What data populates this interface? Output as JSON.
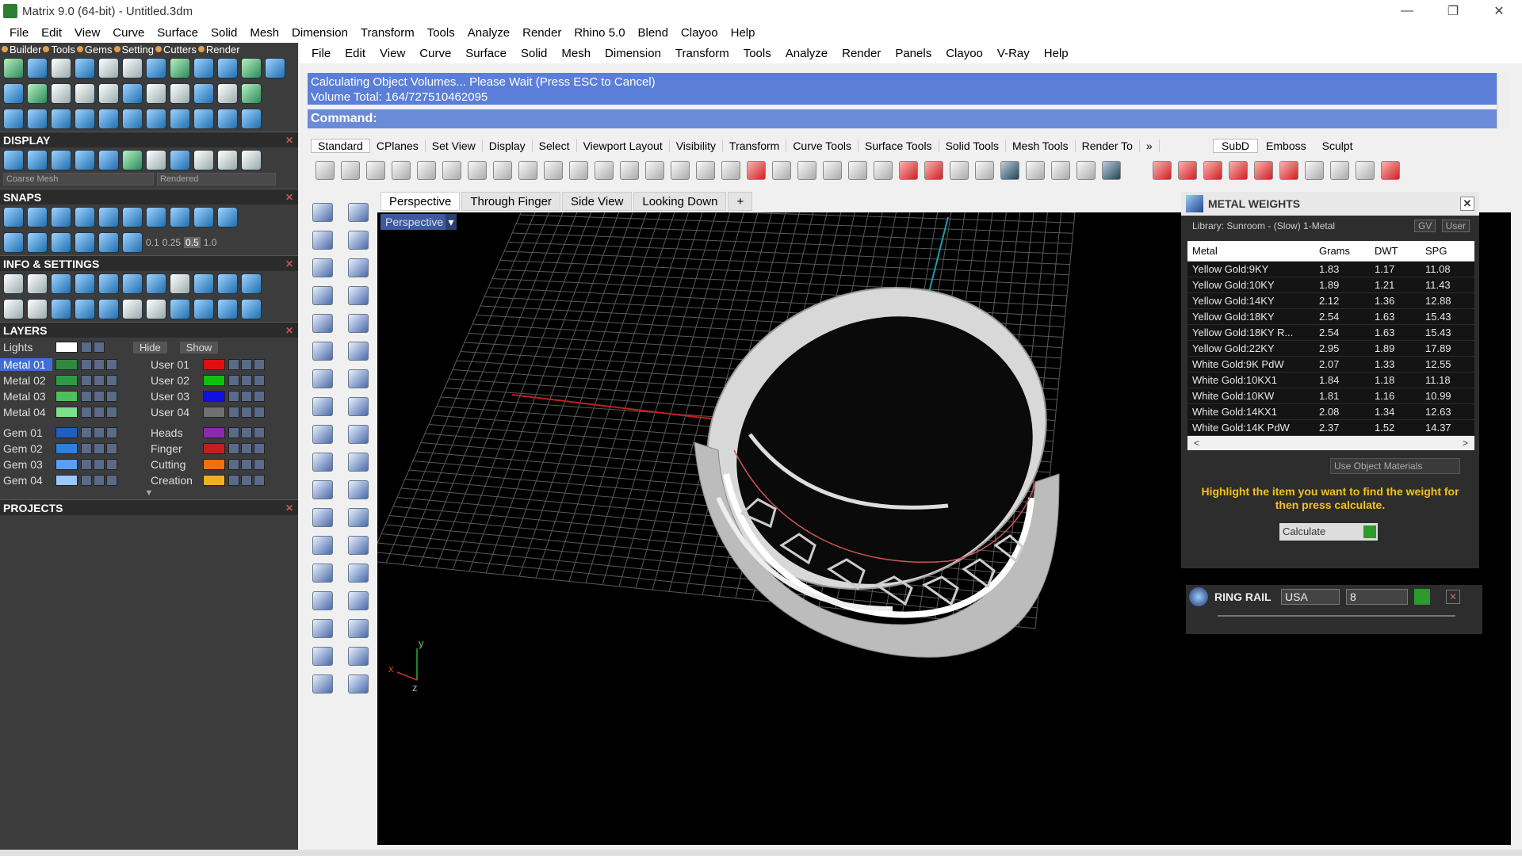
{
  "window": {
    "title": "Matrix 9.0 (64-bit) - Untitled.3dm",
    "minimize": "—",
    "maximize": "❐",
    "close": "✕"
  },
  "top_menu": [
    "File",
    "Edit",
    "View",
    "Curve",
    "Surface",
    "Solid",
    "Mesh",
    "Dimension",
    "Transform",
    "Tools",
    "Analyze",
    "Render",
    "Rhino 5.0",
    "Blend",
    "Clayoo",
    "Help"
  ],
  "left_panel": {
    "tabs": [
      "Builder",
      "Tools",
      "Gems",
      "Setting",
      "Cutters",
      "Render"
    ],
    "sections": {
      "display": "DISPLAY",
      "snaps": "SNAPS",
      "info": "INFO & SETTINGS",
      "layers": "LAYERS",
      "projects": "PROJECTS"
    },
    "display": {
      "mesh_mode": "Coarse Mesh",
      "render_mode": "Rendered"
    },
    "snap_values": [
      "0.1",
      "0.25",
      "0.5",
      "1.0"
    ],
    "layers_header": {
      "lights": "Lights",
      "hide": "Hide",
      "show": "Show"
    },
    "layers_left": [
      {
        "name": "Metal 01",
        "color": "#2e8b3e",
        "selected": true
      },
      {
        "name": "Metal 02",
        "color": "#2e9a45"
      },
      {
        "name": "Metal 03",
        "color": "#4cc05a"
      },
      {
        "name": "Metal 04",
        "color": "#7fe08a"
      },
      {
        "name": "Gem 01",
        "color": "#1f5fc0"
      },
      {
        "name": "Gem 02",
        "color": "#2f7fe0"
      },
      {
        "name": "Gem 03",
        "color": "#5aa0f0"
      },
      {
        "name": "Gem 04",
        "color": "#9ac8ff"
      }
    ],
    "layers_right": [
      {
        "name": "User 01",
        "color": "#e01010"
      },
      {
        "name": "User 02",
        "color": "#10c010"
      },
      {
        "name": "User 03",
        "color": "#1010e0"
      },
      {
        "name": "User 04",
        "color": "#707070"
      },
      {
        "name": "Heads",
        "color": "#8a2ab0"
      },
      {
        "name": "Finger",
        "color": "#c02020"
      },
      {
        "name": "Cutting",
        "color": "#f07010"
      },
      {
        "name": "Creation",
        "color": "#f0b020"
      }
    ]
  },
  "main_menu": [
    "File",
    "Edit",
    "View",
    "Curve",
    "Surface",
    "Solid",
    "Mesh",
    "Dimension",
    "Transform",
    "Tools",
    "Analyze",
    "Render",
    "Panels",
    "Clayoo",
    "V-Ray",
    "Help"
  ],
  "command": {
    "line1": "Calculating Object Volumes... Please Wait (Press ESC to Cancel)",
    "line2": "Volume Total: 164/727510462095",
    "prompt": "Command:"
  },
  "toolbar_tabs": [
    "Standard",
    "CPlanes",
    "Set View",
    "Display",
    "Select",
    "Viewport Layout",
    "Visibility",
    "Transform",
    "Curve Tools",
    "Surface Tools",
    "Solid Tools",
    "Mesh Tools",
    "Render To"
  ],
  "right_tabs": [
    "SubD",
    "Emboss",
    "Sculpt"
  ],
  "viewport_tabs": [
    "Perspective",
    "Through Finger",
    "Side View",
    "Looking Down",
    "+"
  ],
  "viewport_label": "Perspective",
  "axis": {
    "y": "y",
    "z": "z",
    "x": "x"
  },
  "metal_weights": {
    "title": "METAL WEIGHTS",
    "library": "Library: Sunroom - (Slow) 1-Metal",
    "gv": "GV",
    "user": "User",
    "columns": [
      "Metal",
      "Grams",
      "DWT",
      "SPG"
    ],
    "rows": [
      [
        "Yellow Gold:9KY",
        "1.83",
        "1.17",
        "11.08"
      ],
      [
        "Yellow Gold:10KY",
        "1.89",
        "1.21",
        "11.43"
      ],
      [
        "Yellow Gold:14KY",
        "2.12",
        "1.36",
        "12.88"
      ],
      [
        "Yellow Gold:18KY",
        "2.54",
        "1.63",
        "15.43"
      ],
      [
        "Yellow Gold:18KY R...",
        "2.54",
        "1.63",
        "15.43"
      ],
      [
        "Yellow Gold:22KY",
        "2.95",
        "1.89",
        "17.89"
      ],
      [
        "White Gold:9K PdW",
        "2.07",
        "1.33",
        "12.55"
      ],
      [
        "White Gold:10KX1",
        "1.84",
        "1.18",
        "11.18"
      ],
      [
        "White Gold:10KW",
        "1.81",
        "1.16",
        "10.99"
      ],
      [
        "White Gold:14KX1",
        "2.08",
        "1.34",
        "12.63"
      ],
      [
        "White Gold:14K PdW",
        "2.37",
        "1.52",
        "14.37"
      ]
    ],
    "use_object_materials": "Use Object Materials",
    "message": "Highlight the item you want to find the weight for then press calculate.",
    "calculate": "Calculate"
  },
  "ring_rail": {
    "title": "RING RAIL",
    "region": "USA",
    "size": "8"
  }
}
